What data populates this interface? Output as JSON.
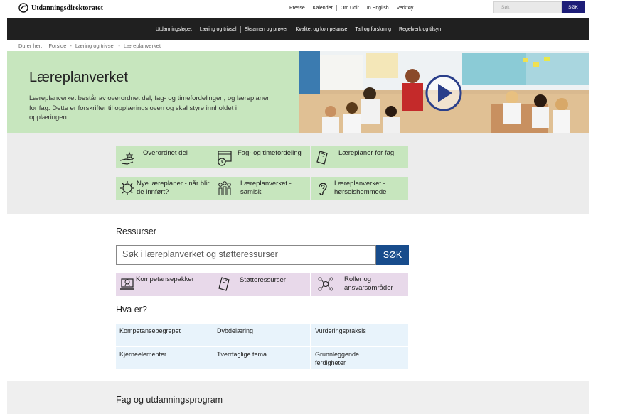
{
  "site": {
    "name": "Utdanningsdirektoratet"
  },
  "top_links": [
    "Presse",
    "Kalender",
    "Om Udir",
    "In English",
    "Verktøy"
  ],
  "top_search": {
    "placeholder": "Søk",
    "button": "SØK"
  },
  "main_nav": [
    "Utdanningsløpet",
    "Læring og trivsel",
    "Eksamen og prøver",
    "Kvalitet og kompetanse",
    "Tall og forskning",
    "Regelverk og tilsyn"
  ],
  "breadcrumb": {
    "label": "Du er her:",
    "items": [
      "Forside",
      "Læring og trivsel",
      "Læreplanverket"
    ],
    "separator": "-"
  },
  "hero": {
    "title": "Læreplanverket",
    "description": "Læreplanverket består av overordnet del, fag- og timefordelingen, og læreplaner for fag. Dette er forskrifter til opplæringsloven og skal styre innholdet i opplæringen."
  },
  "tiles": [
    {
      "icon": "hand-star-icon",
      "label": "Overordnet del"
    },
    {
      "icon": "calendar-clock-icon",
      "label": "Fag- og timefordeling"
    },
    {
      "icon": "notebook-icon",
      "label": "Læreplaner for fag"
    },
    {
      "icon": "gear-icon",
      "label": "Nye læreplaner - når blir de innført?"
    },
    {
      "icon": "people-group-icon",
      "label": "Læreplanverket - samisk"
    },
    {
      "icon": "ear-icon",
      "label": "Læreplanverket - hørselshemmede"
    }
  ],
  "resources": {
    "heading": "Ressurser",
    "search_placeholder": "Søk i læreplanverket og støtteressurser",
    "search_button": "SØK",
    "tiles": [
      {
        "icon": "laptop-badge-icon",
        "label": "Kompetansepakker"
      },
      {
        "icon": "notebook-icon",
        "label": "Støtteressurser"
      },
      {
        "icon": "network-roles-icon",
        "label": "Roller og ansvarsområder"
      }
    ]
  },
  "what_is": {
    "heading": "Hva er?",
    "items": [
      "Kompetansebegrepet",
      "Dybdelæring",
      "Vurderingspraksis",
      "Kjerneelementer",
      "Tverrfaglige tema",
      "Grunnleggende ferdigheter"
    ]
  },
  "subjects": {
    "heading": "Fag og utdanningsprogram"
  },
  "colors": {
    "green": "#c7e6be",
    "purple": "#e8d9ea",
    "lightblue": "#e8f3fb",
    "navy": "#1d1d78",
    "blue": "#184c8c",
    "dark": "#202020"
  }
}
